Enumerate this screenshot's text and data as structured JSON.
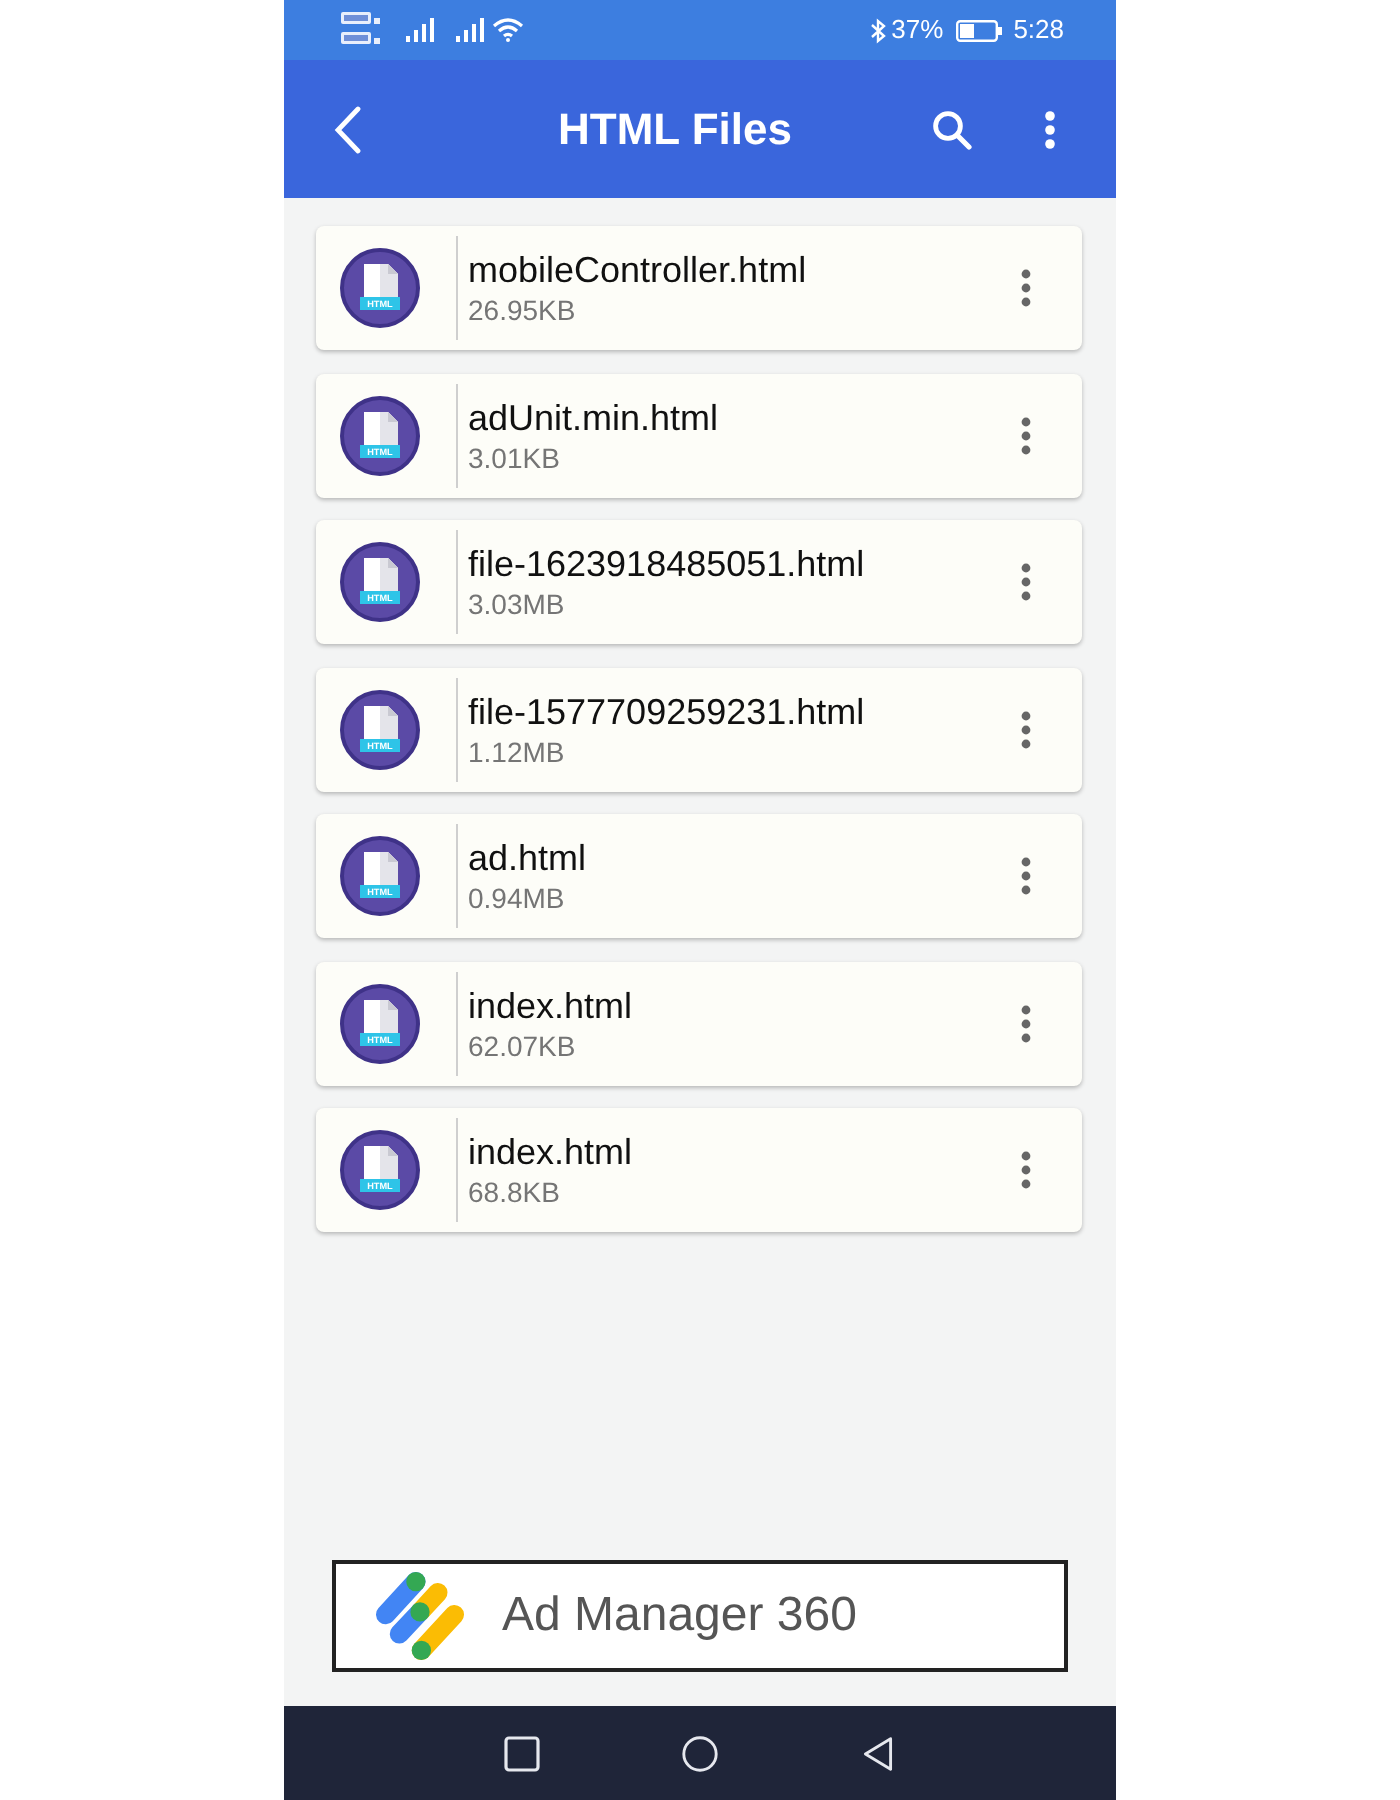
{
  "status_bar": {
    "battery": "37%",
    "time": "5:28"
  },
  "header": {
    "title": "HTML Files"
  },
  "files": [
    {
      "name": "mobileController.html",
      "size": "26.95KB",
      "icon_label": "HTML"
    },
    {
      "name": "adUnit.min.html",
      "size": "3.01KB",
      "icon_label": "HTML"
    },
    {
      "name": "file-1623918485051.html",
      "size": "3.03MB",
      "icon_label": "HTML"
    },
    {
      "name": "file-1577709259231.html",
      "size": "1.12MB",
      "icon_label": "HTML"
    },
    {
      "name": "ad.html",
      "size": "0.94MB",
      "icon_label": "HTML"
    },
    {
      "name": "index.html",
      "size": "62.07KB",
      "icon_label": "HTML"
    },
    {
      "name": "index.html",
      "size": "68.8KB",
      "icon_label": "HTML"
    }
  ],
  "ad": {
    "text": "Ad Manager 360"
  }
}
